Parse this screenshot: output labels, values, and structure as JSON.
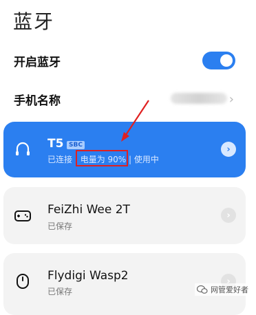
{
  "page": {
    "title": "蓝牙"
  },
  "settings": {
    "bluetooth_toggle": {
      "label": "开启蓝牙",
      "on": true
    },
    "device_name": {
      "label": "手机名称"
    }
  },
  "colors": {
    "accent": "#2b7ff0",
    "card_bg": "#f3f3f3",
    "annotation": "#e02020"
  },
  "devices": [
    {
      "name": "T5",
      "codec": "SBC",
      "status_prefix": "已连接",
      "battery": "电量为 90%",
      "status_suffix": "使用中",
      "icon": "headphones-icon",
      "active": true
    },
    {
      "name": "FeiZhi Wee 2T",
      "status": "已保存",
      "icon": "gamepad-icon",
      "active": false
    },
    {
      "name": "Flydigi Wasp2",
      "status": "已保存",
      "icon": "mouse-icon",
      "active": false
    }
  ],
  "watermark": {
    "text": "网管爱好者"
  }
}
